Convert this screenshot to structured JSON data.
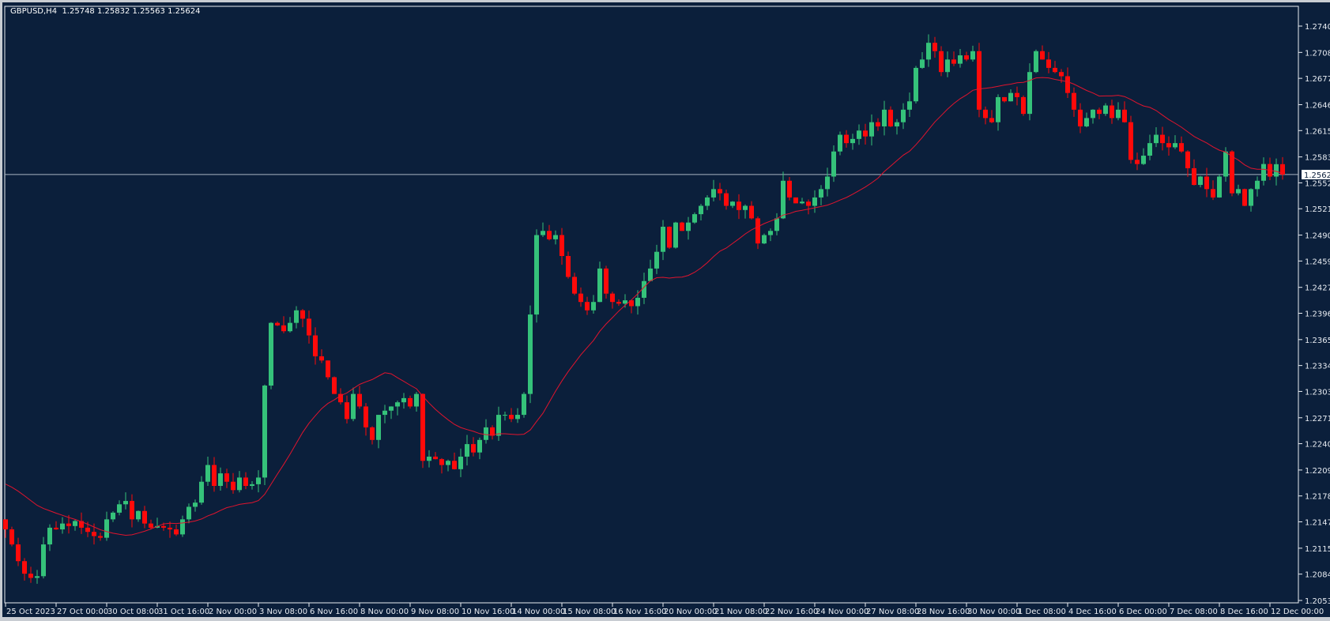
{
  "header": {
    "symbol": "GBPUSD,H4",
    "open": "1.25748",
    "high": "1.25832",
    "low": "1.25563",
    "close": "1.25624"
  },
  "colors": {
    "background": "#0b1f3b",
    "bull": "#35c27a",
    "bear": "#ff0a0a",
    "ma": "#e0142e",
    "grid_text": "#e8ecf2",
    "bid_line": "#a9b4c2"
  },
  "price_axis": {
    "ticks": [
      "1.27400",
      "1.27085",
      "1.26775",
      "1.26460",
      "1.26150",
      "1.25835",
      "1.25525",
      "1.25215",
      "1.24900",
      "1.24590",
      "1.24275",
      "1.23965",
      "1.23650",
      "1.23340",
      "1.23030",
      "1.22715",
      "1.22405",
      "1.22090",
      "1.21780",
      "1.21470",
      "1.21155",
      "1.20845",
      "1.20530"
    ],
    "current_price": "1.25624"
  },
  "time_axis": {
    "labels": [
      "25 Oct 2023",
      "27 Oct 00:00",
      "30 Oct 08:00",
      "31 Oct 16:00",
      "2 Nov 00:00",
      "3 Nov 08:00",
      "6 Nov 16:00",
      "8 Nov 00:00",
      "9 Nov 08:00",
      "10 Nov 16:00",
      "14 Nov 00:00",
      "15 Nov 08:00",
      "16 Nov 16:00",
      "20 Nov 00:00",
      "21 Nov 08:00",
      "22 Nov 16:00",
      "24 Nov 00:00",
      "27 Nov 08:00",
      "28 Nov 16:00",
      "30 Nov 00:00",
      "1 Dec 08:00",
      "4 Dec 16:00",
      "6 Dec 00:00",
      "7 Dec 08:00",
      "8 Dec 16:00",
      "12 Dec 00:00"
    ],
    "bars_per_label": 8
  },
  "chart_data": {
    "type": "candlestick",
    "title": "GBPUSD,H4",
    "timeframe": "H4",
    "ylim": [
      1.2053,
      1.274
    ],
    "first_open": 1.215,
    "closes": [
      1.2138,
      1.212,
      1.21,
      1.2085,
      1.208,
      1.2082,
      1.212,
      1.214,
      1.2138,
      1.2145,
      1.2142,
      1.2148,
      1.214,
      1.2135,
      1.213,
      1.2128,
      1.215,
      1.2158,
      1.2168,
      1.2172,
      1.215,
      1.216,
      1.2145,
      1.214,
      1.2142,
      1.214,
      1.2138,
      1.2132,
      1.215,
      1.2165,
      1.217,
      1.2195,
      1.2215,
      1.219,
      1.2205,
      1.2195,
      1.2185,
      1.22,
      1.219,
      1.2192,
      1.22,
      1.231,
      1.2385,
      1.2382,
      1.2375,
      1.2385,
      1.24,
      1.239,
      1.237,
      1.2345,
      1.234,
      1.232,
      1.23,
      1.229,
      1.227,
      1.23,
      1.2285,
      1.226,
      1.2245,
      1.2275,
      1.228,
      1.2285,
      1.229,
      1.2295,
      1.2285,
      1.23,
      1.222,
      1.2225,
      1.2222,
      1.2215,
      1.222,
      1.221,
      1.2225,
      1.224,
      1.223,
      1.2245,
      1.226,
      1.225,
      1.2275,
      1.2275,
      1.227,
      1.2275,
      1.23,
      1.2395,
      1.249,
      1.2495,
      1.2485,
      1.249,
      1.2465,
      1.244,
      1.242,
      1.241,
      1.24,
      1.241,
      1.245,
      1.242,
      1.241,
      1.2408,
      1.2412,
      1.2405,
      1.2415,
      1.2435,
      1.245,
      1.247,
      1.25,
      1.2475,
      1.2505,
      1.2495,
      1.2505,
      1.2515,
      1.2525,
      1.2535,
      1.2545,
      1.254,
      1.2525,
      1.253,
      1.252,
      1.2525,
      1.251,
      1.248,
      1.249,
      1.2495,
      1.251,
      1.2555,
      1.2535,
      1.2528,
      1.253,
      1.2525,
      1.2535,
      1.2545,
      1.256,
      1.259,
      1.261,
      1.26,
      1.2605,
      1.2615,
      1.2608,
      1.2625,
      1.262,
      1.264,
      1.262,
      1.2625,
      1.264,
      1.265,
      1.269,
      1.27,
      1.272,
      1.271,
      1.2685,
      1.27,
      1.2695,
      1.2705,
      1.27,
      1.271,
      1.264,
      1.263,
      1.2625,
      1.2655,
      1.265,
      1.266,
      1.2655,
      1.2635,
      1.2685,
      1.271,
      1.27,
      1.269,
      1.2685,
      1.268,
      1.266,
      1.264,
      1.262,
      1.263,
      1.264,
      1.2635,
      1.2645,
      1.263,
      1.264,
      1.2625,
      1.258,
      1.2575,
      1.2585,
      1.26,
      1.261,
      1.26,
      1.2595,
      1.26,
      1.259,
      1.257,
      1.255,
      1.256,
      1.2545,
      1.2535,
      1.256,
      1.259,
      1.254,
      1.2545,
      1.2525,
      1.2545,
      1.2555,
      1.2575,
      1.256,
      1.25748,
      1.25624
    ],
    "last_bar": {
      "open": 1.25748,
      "high": 1.25832,
      "low": 1.25563,
      "close": 1.25624
    },
    "indicator": {
      "type": "moving-average",
      "period": 20
    }
  }
}
